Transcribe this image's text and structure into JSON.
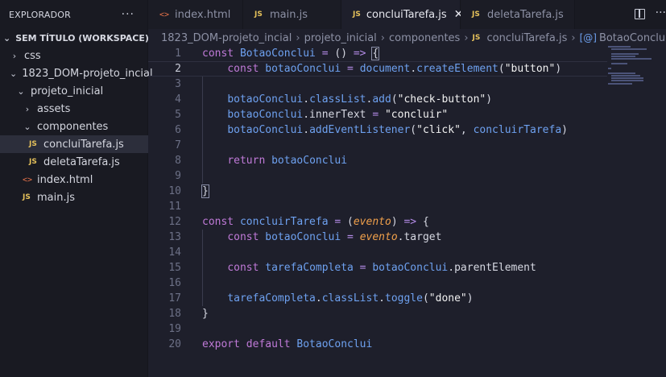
{
  "sidebar": {
    "title": "EXPLORADOR",
    "more": "···",
    "tree": [
      {
        "label": "SEM TÍTULO (WORKSPACE)",
        "type": "root",
        "chevron": "⌄",
        "indent": 0
      },
      {
        "label": "css",
        "type": "folder",
        "chevron": "›",
        "indent": 1
      },
      {
        "label": "1823_DOM-projeto_incial",
        "type": "folder",
        "chevron": "⌄",
        "indent": 1
      },
      {
        "label": "projeto_inicial",
        "type": "folder",
        "chevron": "⌄",
        "indent": 2
      },
      {
        "label": "assets",
        "type": "folder",
        "chevron": "›",
        "indent": 3
      },
      {
        "label": "componentes",
        "type": "folder",
        "chevron": "⌄",
        "indent": 3
      },
      {
        "label": "concluiTarefa.js",
        "type": "js",
        "badge": "JS",
        "indent": 4,
        "active": true
      },
      {
        "label": "deletaTarefa.js",
        "type": "js",
        "badge": "JS",
        "indent": 4
      },
      {
        "label": "index.html",
        "type": "html",
        "badge": "<>",
        "indent": 3
      },
      {
        "label": "main.js",
        "type": "js",
        "badge": "JS",
        "indent": 3
      }
    ]
  },
  "tabs": [
    {
      "label": "index.html",
      "badge": "<>",
      "type": "html"
    },
    {
      "label": "main.js",
      "badge": "JS",
      "type": "js"
    },
    {
      "label": "concluiTarefa.js",
      "badge": "JS",
      "type": "js",
      "active": true,
      "close": "✕"
    },
    {
      "label": "deletaTarefa.js",
      "badge": "JS",
      "type": "js"
    }
  ],
  "tab_more": "···",
  "breadcrumb": {
    "parts": [
      "1823_DOM-projeto_incial",
      "projeto_inicial",
      "componentes"
    ],
    "file_badge": "JS",
    "file": "concluiTarefa.js",
    "symbol_icon": "[@]",
    "symbol": "BotaoConclui",
    "separator": "›"
  },
  "editor": {
    "current_line": 2,
    "lines": [
      {
        "n": "1",
        "tokens": [
          [
            "kw",
            "const "
          ],
          [
            "fn",
            "BotaoConclui"
          ],
          [
            "op",
            " = "
          ],
          [
            "txt",
            "() "
          ],
          [
            "op",
            "=> "
          ],
          [
            "brk",
            "{"
          ]
        ]
      },
      {
        "n": "2",
        "tokens": [
          [
            "txt",
            "    "
          ],
          [
            "kw",
            "const "
          ],
          [
            "fn",
            "botaoConclui"
          ],
          [
            "op",
            " = "
          ],
          [
            "fn",
            "document"
          ],
          [
            "txt",
            "."
          ],
          [
            "fn",
            "createElement"
          ],
          [
            "txt",
            "("
          ],
          [
            "str",
            "\"button\""
          ],
          [
            "txt",
            ")"
          ]
        ]
      },
      {
        "n": "3",
        "tokens": []
      },
      {
        "n": "4",
        "tokens": [
          [
            "txt",
            "    "
          ],
          [
            "fn",
            "botaoConclui"
          ],
          [
            "txt",
            "."
          ],
          [
            "fn",
            "classList"
          ],
          [
            "txt",
            "."
          ],
          [
            "fn",
            "add"
          ],
          [
            "txt",
            "("
          ],
          [
            "str",
            "\"check-button\""
          ],
          [
            "txt",
            ")"
          ]
        ]
      },
      {
        "n": "5",
        "tokens": [
          [
            "txt",
            "    "
          ],
          [
            "fn",
            "botaoConclui"
          ],
          [
            "txt",
            ".innerText "
          ],
          [
            "op",
            "= "
          ],
          [
            "str",
            "\"concluir\""
          ]
        ]
      },
      {
        "n": "6",
        "tokens": [
          [
            "txt",
            "    "
          ],
          [
            "fn",
            "botaoConclui"
          ],
          [
            "txt",
            "."
          ],
          [
            "fn",
            "addEventListener"
          ],
          [
            "txt",
            "("
          ],
          [
            "str",
            "\"click\""
          ],
          [
            "txt",
            ", "
          ],
          [
            "fn",
            "concluirTarefa"
          ],
          [
            "txt",
            ")"
          ]
        ]
      },
      {
        "n": "7",
        "tokens": []
      },
      {
        "n": "8",
        "tokens": [
          [
            "txt",
            "    "
          ],
          [
            "kw",
            "return "
          ],
          [
            "fn",
            "botaoConclui"
          ]
        ]
      },
      {
        "n": "9",
        "tokens": []
      },
      {
        "n": "10",
        "tokens": [
          [
            "brk",
            "}"
          ]
        ]
      },
      {
        "n": "11",
        "tokens": []
      },
      {
        "n": "12",
        "tokens": [
          [
            "kw",
            "const "
          ],
          [
            "fn",
            "concluirTarefa"
          ],
          [
            "op",
            " = "
          ],
          [
            "txt",
            "("
          ],
          [
            "param",
            "evento"
          ],
          [
            "txt",
            ") "
          ],
          [
            "op",
            "=> "
          ],
          [
            "txt",
            "{"
          ]
        ]
      },
      {
        "n": "13",
        "tokens": [
          [
            "txt",
            "    "
          ],
          [
            "kw",
            "const "
          ],
          [
            "fn",
            "botaoConclui"
          ],
          [
            "op",
            " = "
          ],
          [
            "param",
            "evento"
          ],
          [
            "txt",
            ".target"
          ]
        ]
      },
      {
        "n": "14",
        "tokens": []
      },
      {
        "n": "15",
        "tokens": [
          [
            "txt",
            "    "
          ],
          [
            "kw",
            "const "
          ],
          [
            "fn",
            "tarefaCompleta"
          ],
          [
            "op",
            " = "
          ],
          [
            "fn",
            "botaoConclui"
          ],
          [
            "txt",
            ".parentElement"
          ]
        ]
      },
      {
        "n": "16",
        "tokens": []
      },
      {
        "n": "17",
        "tokens": [
          [
            "txt",
            "    "
          ],
          [
            "fn",
            "tarefaCompleta"
          ],
          [
            "txt",
            "."
          ],
          [
            "fn",
            "classList"
          ],
          [
            "txt",
            "."
          ],
          [
            "fn",
            "toggle"
          ],
          [
            "txt",
            "("
          ],
          [
            "str",
            "\"done\""
          ],
          [
            "txt",
            ")"
          ]
        ]
      },
      {
        "n": "18",
        "tokens": [
          [
            "txt",
            "}"
          ]
        ]
      },
      {
        "n": "19",
        "tokens": []
      },
      {
        "n": "20",
        "tokens": [
          [
            "kw",
            "export default "
          ],
          [
            "fn",
            "BotaoConclui"
          ]
        ]
      }
    ]
  }
}
